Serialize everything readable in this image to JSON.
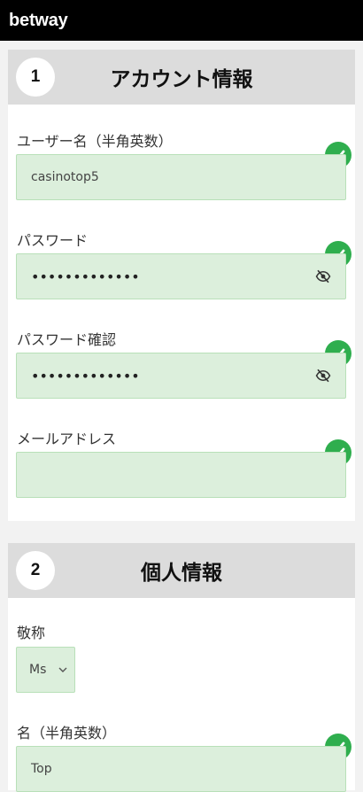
{
  "brand": {
    "logo_text": "betway"
  },
  "account_section": {
    "step": "1",
    "title": "アカウント情報",
    "fields": [
      {
        "label": "ユーザー名（半角英数）",
        "value": "casinotop5",
        "valid": true
      },
      {
        "label": "パスワード",
        "value": "•••••••••••••",
        "masked": true,
        "valid": true
      },
      {
        "label": "パスワード確認",
        "value": "•••••••••••••",
        "masked": true,
        "valid": true
      },
      {
        "label": "メールアドレス",
        "value": "",
        "valid": true
      }
    ]
  },
  "personal_section": {
    "step": "2",
    "title": "個人情報",
    "honorific": {
      "label": "敬称",
      "selected": "Ms"
    },
    "first_name": {
      "label": "名（半角英数）",
      "value": "Top",
      "valid": true
    }
  },
  "colors": {
    "accent_green": "#2fae4e",
    "input_bg": "#dcefdc",
    "header_bg": "#dcdcdc",
    "topbar_bg": "#000000"
  }
}
